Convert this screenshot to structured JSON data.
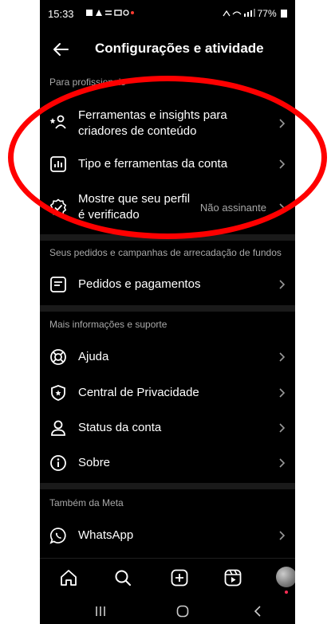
{
  "statusbar": {
    "time": "15:33",
    "right": "77%"
  },
  "header": {
    "title": "Configurações e atividade"
  },
  "sections": {
    "professionals": "Para profissionais",
    "orders": "Seus pedidos e campanhas de arrecadação de fundos",
    "support": "Mais informações e suporte",
    "meta": "Também da Meta"
  },
  "rows": {
    "creator_tools": "Ferramentas e insights para criadores de conteúdo",
    "account_type": "Tipo e ferramentas da conta",
    "verified": "Mostre que seu perfil é verificado",
    "verified_value": "Não assinante",
    "orders_payments": "Pedidos e pagamentos",
    "help": "Ajuda",
    "privacy_center": "Central de Privacidade",
    "account_status": "Status da conta",
    "about": "Sobre",
    "whatsapp": "WhatsApp"
  },
  "colors": {
    "background": "#000000",
    "muted": "#a8a8a8",
    "annotation": "#ff0000"
  }
}
